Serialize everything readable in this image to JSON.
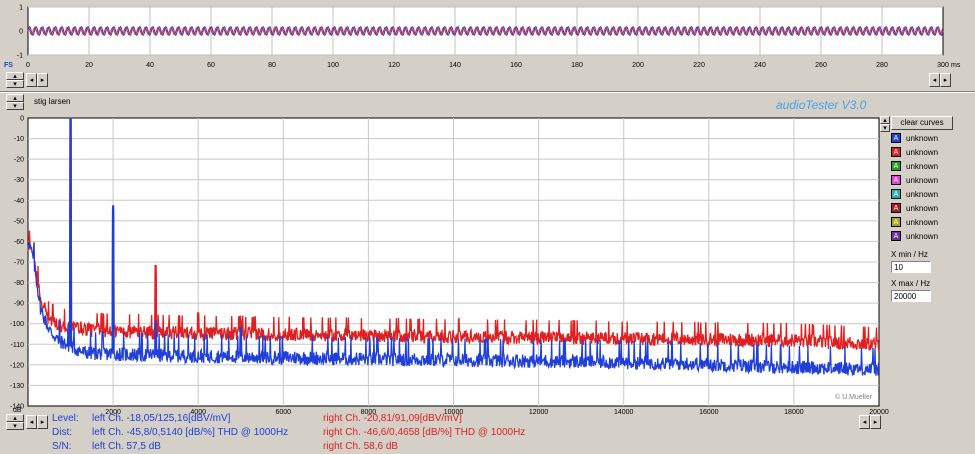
{
  "brand": "audioTester  V3.0",
  "channel_name": "stig larsen",
  "copyright": "© U.Mueller",
  "clear_label": "clear curves",
  "legend": [
    {
      "glyph": "A",
      "label": "unknown",
      "color": "#1f3fd8"
    },
    {
      "glyph": "A",
      "label": "unknown",
      "color": "#e02020"
    },
    {
      "glyph": "A",
      "label": "unknown",
      "color": "#20a020"
    },
    {
      "glyph": "A",
      "label": "unknown",
      "color": "#e040e0"
    },
    {
      "glyph": "A",
      "label": "unknown",
      "color": "#20b0b0"
    },
    {
      "glyph": "A",
      "label": "unknown",
      "color": "#a02020"
    },
    {
      "glyph": "A",
      "label": "unknown",
      "color": "#b0a020"
    },
    {
      "glyph": "A",
      "label": "unknown",
      "color": "#7030a0"
    }
  ],
  "xmin_label": "X min / Hz",
  "xmin_value": "10",
  "xmax_label": "X max / Hz",
  "xmax_value": "20000",
  "summary": {
    "level_label": "Level:",
    "dist_label": "Dist:",
    "sn_label": "S/N:",
    "left_level": "left Ch. -18,05/125,16[dBV/mV]",
    "left_dist": "left Ch. -45,8/0,5140 [dB/%] THD @ 1000Hz",
    "left_sn": "left Ch. 57,5 dB",
    "right_level": "right Ch. -20,81/91,09[dBV/mV]",
    "right_dist": "right Ch. -46,6/0,4658 [dB/%] THD @ 1000Hz",
    "right_sn": "right Ch. 58,6 dB"
  },
  "colors": {
    "left": "#1f3fd8",
    "right": "#e02020",
    "brand": "#4aa0e8"
  },
  "chart_data": [
    {
      "type": "line",
      "xunit": "ms",
      "fs_label": "FS",
      "xlim": [
        0,
        300
      ],
      "ylim": [
        -1,
        1
      ],
      "xticks": [
        0,
        20,
        40,
        60,
        80,
        100,
        120,
        140,
        160,
        180,
        200,
        220,
        240,
        260,
        280,
        300
      ],
      "yticks": [
        1,
        0,
        -1
      ],
      "grid": true,
      "signal_frequency_hz": 1000,
      "series": [
        {
          "color": "#1f3fd8",
          "amplitude": 0.18
        },
        {
          "color": "#e02020",
          "amplitude": 0.15
        }
      ]
    },
    {
      "type": "line",
      "yunit": "dB",
      "xlim": [
        0,
        20000
      ],
      "ylim": [
        -140,
        0
      ],
      "xticks": [
        2000,
        4000,
        6000,
        8000,
        10000,
        12000,
        14000,
        16000,
        18000,
        20000
      ],
      "yticks": [
        0,
        -10,
        -20,
        -30,
        -40,
        -50,
        -60,
        -70,
        -80,
        -90,
        -100,
        -110,
        -120,
        -130,
        -140
      ],
      "grid": true,
      "series": [
        {
          "color": "#1f3fd8",
          "points": [
            [
              10,
              -60
            ],
            [
              120,
              -68
            ],
            [
              300,
              -93
            ],
            [
              500,
              -103
            ],
            [
              700,
              -108
            ],
            [
              900,
              -110
            ],
            [
              1300,
              -114
            ],
            [
              2500,
              -115
            ],
            [
              5000,
              -116
            ],
            [
              8000,
              -117
            ],
            [
              12000,
              -118
            ],
            [
              15000,
              -119
            ],
            [
              18000,
              -121
            ],
            [
              20000,
              -122
            ]
          ],
          "peaks": [
            [
              1000,
              0
            ],
            [
              2000,
              -46
            ],
            [
              3000,
              -102
            ],
            [
              5000,
              -105
            ]
          ]
        },
        {
          "color": "#e02020",
          "points": [
            [
              10,
              -62
            ],
            [
              120,
              -66
            ],
            [
              300,
              -88
            ],
            [
              500,
              -98
            ],
            [
              800,
              -101
            ],
            [
              1500,
              -103
            ],
            [
              3000,
              -104
            ],
            [
              6000,
              -105
            ],
            [
              10000,
              -106
            ],
            [
              14000,
              -107
            ],
            [
              18000,
              -108
            ],
            [
              20000,
              -110
            ]
          ],
          "peaks": [
            [
              1000,
              -1
            ],
            [
              2000,
              -48
            ],
            [
              3000,
              -75
            ],
            [
              4000,
              -98
            ],
            [
              5000,
              -102
            ]
          ]
        }
      ]
    }
  ]
}
